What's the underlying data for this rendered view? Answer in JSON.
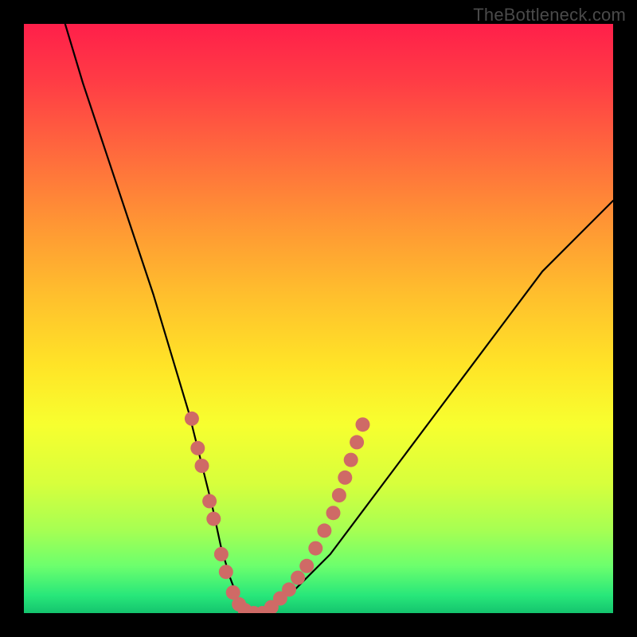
{
  "watermark": "TheBottleneck.com",
  "chart_data": {
    "type": "line",
    "title": "",
    "xlabel": "",
    "ylabel": "",
    "xlim": [
      0,
      100
    ],
    "ylim": [
      0,
      100
    ],
    "grid": false,
    "legend": false,
    "series": [
      {
        "name": "bottleneck-curve",
        "x": [
          7,
          10,
          14,
          18,
          22,
          25,
          28,
          30,
          32,
          33.5,
          35,
          36.5,
          38,
          40,
          46,
          52,
          58,
          64,
          70,
          76,
          82,
          88,
          94,
          100
        ],
        "y": [
          100,
          90,
          78,
          66,
          54,
          44,
          34,
          26,
          18,
          11,
          6,
          2,
          0,
          0,
          4,
          10,
          18,
          26,
          34,
          42,
          50,
          58,
          64,
          70
        ]
      }
    ],
    "markers": {
      "name": "highlighted-points",
      "color": "#cf6a66",
      "points": [
        {
          "x": 28.5,
          "y": 33
        },
        {
          "x": 29.5,
          "y": 28
        },
        {
          "x": 30.2,
          "y": 25
        },
        {
          "x": 31.5,
          "y": 19
        },
        {
          "x": 32.2,
          "y": 16
        },
        {
          "x": 33.5,
          "y": 10
        },
        {
          "x": 34.3,
          "y": 7
        },
        {
          "x": 35.5,
          "y": 3.5
        },
        {
          "x": 36.5,
          "y": 1.5
        },
        {
          "x": 37.5,
          "y": 0.5
        },
        {
          "x": 39,
          "y": 0
        },
        {
          "x": 40.5,
          "y": 0
        },
        {
          "x": 42,
          "y": 1
        },
        {
          "x": 43.5,
          "y": 2.5
        },
        {
          "x": 45,
          "y": 4
        },
        {
          "x": 46.5,
          "y": 6
        },
        {
          "x": 48,
          "y": 8
        },
        {
          "x": 49.5,
          "y": 11
        },
        {
          "x": 51,
          "y": 14
        },
        {
          "x": 52.5,
          "y": 17
        },
        {
          "x": 53.5,
          "y": 20
        },
        {
          "x": 54.5,
          "y": 23
        },
        {
          "x": 55.5,
          "y": 26
        },
        {
          "x": 56.5,
          "y": 29
        },
        {
          "x": 57.5,
          "y": 32
        }
      ]
    },
    "gradient_stops": [
      {
        "pos": 0,
        "color": "#ff1f4a"
      },
      {
        "pos": 50,
        "color": "#ffe427"
      },
      {
        "pos": 100,
        "color": "#14c46e"
      }
    ]
  }
}
